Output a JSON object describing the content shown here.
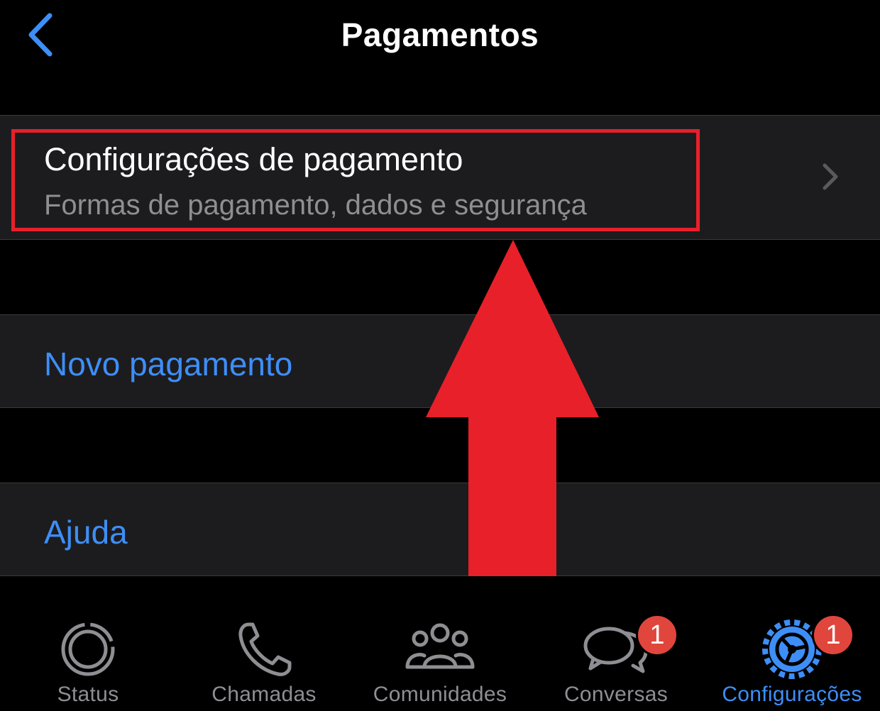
{
  "header": {
    "title": "Pagamentos",
    "back_icon": "chevron-left-icon"
  },
  "payment_settings": {
    "title": "Configurações de pagamento",
    "subtitle": "Formas de pagamento, dados e segurança",
    "chevron_icon": "chevron-right-icon"
  },
  "new_payment": {
    "label": "Novo pagamento"
  },
  "help": {
    "label": "Ajuda"
  },
  "annotation": {
    "color": "#e8202a"
  },
  "tabs": [
    {
      "label": "Status",
      "icon": "status-ring-icon",
      "badge": "",
      "active": false
    },
    {
      "label": "Chamadas",
      "icon": "phone-icon",
      "badge": "",
      "active": false
    },
    {
      "label": "Comunidades",
      "icon": "people-group-icon",
      "badge": "",
      "active": false
    },
    {
      "label": "Conversas",
      "icon": "chat-bubbles-icon",
      "badge": "1",
      "active": false
    },
    {
      "label": "Configurações",
      "icon": "gear-icon",
      "badge": "1",
      "active": true
    }
  ],
  "colors": {
    "background": "#000000",
    "cell": "#1c1c1e",
    "accent": "#3e8ef7",
    "secondary_text": "#8e8e93",
    "badge": "#e0463c"
  }
}
